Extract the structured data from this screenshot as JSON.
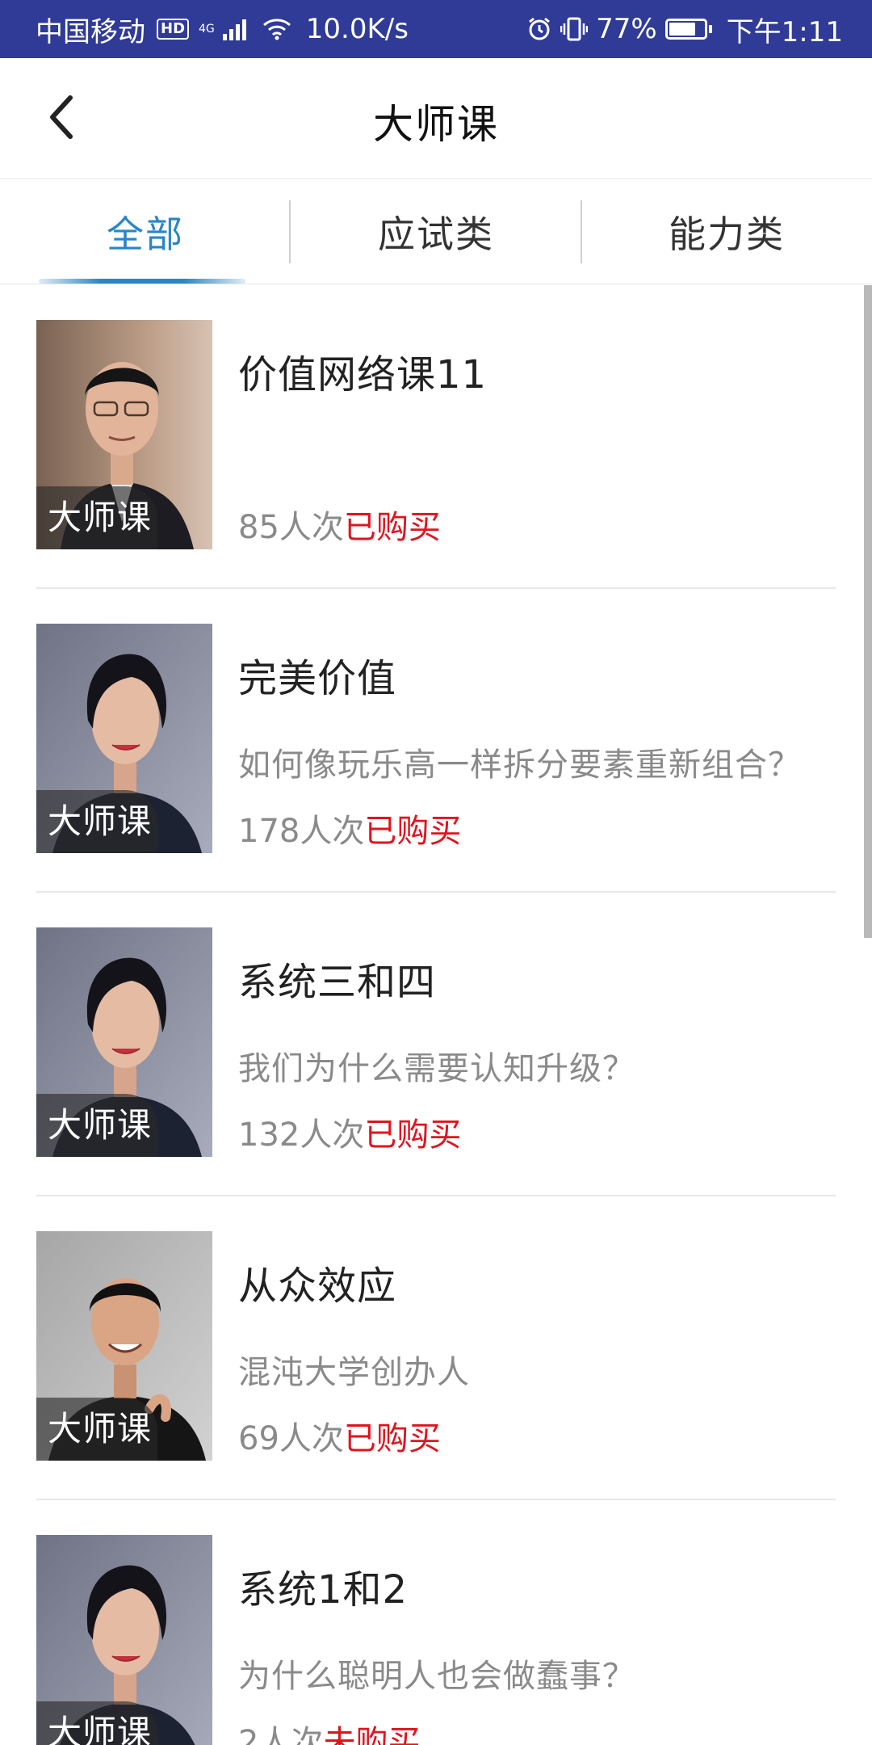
{
  "status_bar": {
    "carrier": "中国移动",
    "hd": "HD",
    "network": "4G",
    "speed": "10.0K/s",
    "battery_percent": "77%",
    "time": "下午1:11"
  },
  "header": {
    "title": "大师课"
  },
  "tabs": [
    {
      "label": "全部",
      "active": true
    },
    {
      "label": "应试类",
      "active": false
    },
    {
      "label": "能力类",
      "active": false
    }
  ],
  "courses": [
    {
      "badge": "大师课",
      "title": "价值网络课11",
      "subtitle": "",
      "count": "85人次",
      "status": "已购买"
    },
    {
      "badge": "大师课",
      "title": "完美价值",
      "subtitle": "如何像玩乐高一样拆分要素重新组合？",
      "count": "178人次",
      "status": "已购买"
    },
    {
      "badge": "大师课",
      "title": "系统三和四",
      "subtitle": "我们为什么需要认知升级？",
      "count": "132人次",
      "status": "已购买"
    },
    {
      "badge": "大师课",
      "title": "从众效应",
      "subtitle": "混沌大学创办人",
      "count": "69人次",
      "status": "已购买"
    },
    {
      "badge": "大师课",
      "title": "系统1和2",
      "subtitle": "为什么聪明人也会做蠢事？",
      "count": "2人次",
      "status": "未购买"
    }
  ],
  "colors": {
    "status_bar": "#2f3b96",
    "tab_active": "#2a86c6",
    "status_red": "#e0141e"
  }
}
